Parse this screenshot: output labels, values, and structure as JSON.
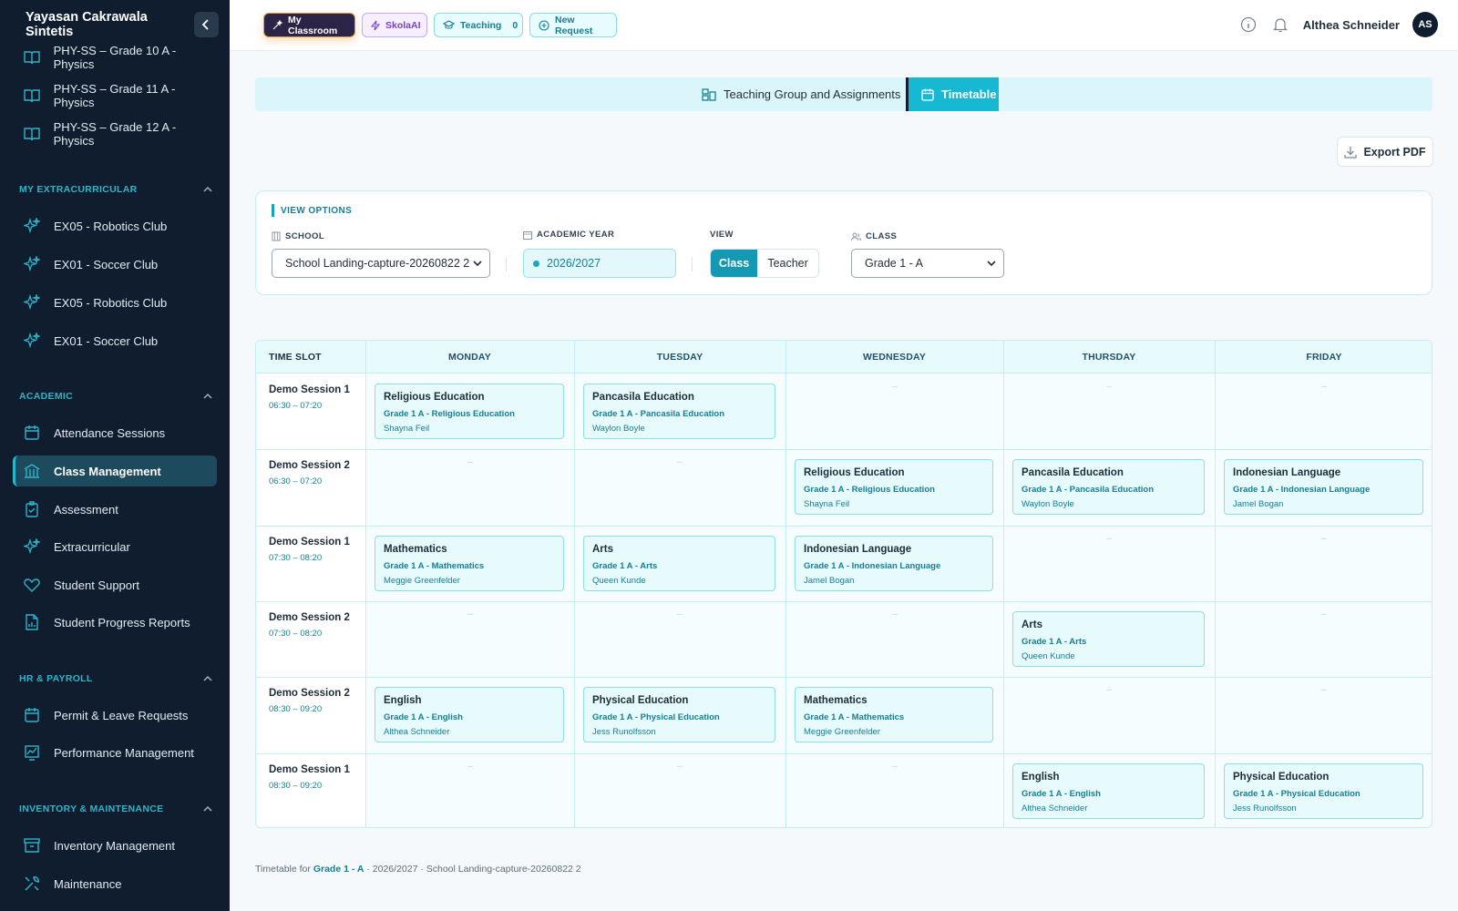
{
  "sidebar": {
    "title": "Yayasan Cakrawala Sintetis",
    "courses": [
      {
        "label": "PHY-SS – Grade 10 A - Physics"
      },
      {
        "label": "PHY-SS – Grade 11 A - Physics"
      },
      {
        "label": "PHY-SS – Grade 12 A - Physics"
      }
    ],
    "extracurricular_title": "MY EXTRACURRICULAR",
    "extracurricular": [
      {
        "label": "EX05 - Robotics Club"
      },
      {
        "label": "EX01 - Soccer Club"
      },
      {
        "label": "EX05 - Robotics Club"
      },
      {
        "label": "EX01 - Soccer Club"
      }
    ],
    "academic_title": "ACADEMIC",
    "academic": [
      {
        "label": "Attendance Sessions"
      },
      {
        "label": "Class Management"
      },
      {
        "label": "Assessment"
      },
      {
        "label": "Extracurricular"
      },
      {
        "label": "Student Support"
      },
      {
        "label": "Student Progress Reports"
      }
    ],
    "hr_title": "HR & PAYROLL",
    "hr": [
      {
        "label": "Permit & Leave Requests"
      },
      {
        "label": "Performance Management"
      }
    ],
    "inventory_title": "INVENTORY & MAINTENANCE",
    "inventory": [
      {
        "label": "Inventory Management"
      },
      {
        "label": "Maintenance"
      }
    ]
  },
  "topbar": {
    "pills": {
      "classroom": "My Classroom",
      "ai": "SkolaAI",
      "teaching": "Teaching",
      "teaching_count": "0",
      "request": "New Request"
    },
    "user_name": "Althea Schneider",
    "avatar_initials": "AS"
  },
  "tabs": {
    "groups": "Teaching Group and Assignments",
    "timetable": "Timetable"
  },
  "export_label": "Export PDF",
  "view_options": {
    "title": "VIEW OPTIONS",
    "school_label": "SCHOOL",
    "school_value": "School Landing-capture-20260822 2",
    "year_label": "ACADEMIC YEAR",
    "year_value": "2026/2027",
    "view_label": "VIEW",
    "view_class": "Class",
    "view_teacher": "Teacher",
    "class_label": "CLASS",
    "class_value": "Grade 1 - A"
  },
  "timetable": {
    "header_slot": "TIME SLOT",
    "days": [
      "MONDAY",
      "TUESDAY",
      "WEDNESDAY",
      "THURSDAY",
      "FRIDAY"
    ],
    "empty_mark": "–",
    "rows": [
      {
        "name": "Demo Session 1",
        "time": "06:30 – 07:20",
        "cells": [
          {
            "subject": "Religious Education",
            "group": "Grade 1 A - Religious Education",
            "teacher": "Shayna Feil"
          },
          {
            "subject": "Pancasila Education",
            "group": "Grade 1 A - Pancasila Education",
            "teacher": "Waylon Boyle"
          },
          null,
          null,
          null
        ]
      },
      {
        "name": "Demo Session 2",
        "time": "06:30 – 07:20",
        "cells": [
          null,
          null,
          {
            "subject": "Religious Education",
            "group": "Grade 1 A - Religious Education",
            "teacher": "Shayna Feil"
          },
          {
            "subject": "Pancasila Education",
            "group": "Grade 1 A - Pancasila Education",
            "teacher": "Waylon Boyle"
          },
          {
            "subject": "Indonesian Language",
            "group": "Grade 1 A - Indonesian Language",
            "teacher": "Jamel Bogan"
          }
        ]
      },
      {
        "name": "Demo Session 1",
        "time": "07:30 – 08:20",
        "cells": [
          {
            "subject": "Mathematics",
            "group": "Grade 1 A - Mathematics",
            "teacher": "Meggie Greenfelder"
          },
          {
            "subject": "Arts",
            "group": "Grade 1 A - Arts",
            "teacher": "Queen Kunde"
          },
          {
            "subject": "Indonesian Language",
            "group": "Grade 1 A - Indonesian Language",
            "teacher": "Jamel Bogan"
          },
          null,
          null
        ]
      },
      {
        "name": "Demo Session 2",
        "time": "07:30 – 08:20",
        "cells": [
          null,
          null,
          null,
          {
            "subject": "Arts",
            "group": "Grade 1 A - Arts",
            "teacher": "Queen Kunde"
          },
          null
        ]
      },
      {
        "name": "Demo Session 2",
        "time": "08:30 – 09:20",
        "cells": [
          {
            "subject": "English",
            "group": "Grade 1 A - English",
            "teacher": "Althea Schneider"
          },
          {
            "subject": "Physical Education",
            "group": "Grade 1 A - Physical Education",
            "teacher": "Jess Runolfsson"
          },
          {
            "subject": "Mathematics",
            "group": "Grade 1 A - Mathematics",
            "teacher": "Meggie Greenfelder"
          },
          null,
          null
        ]
      },
      {
        "name": "Demo Session 1",
        "time": "08:30 – 09:20",
        "cells": [
          null,
          null,
          null,
          {
            "subject": "English",
            "group": "Grade 1 A - English",
            "teacher": "Althea Schneider"
          },
          {
            "subject": "Physical Education",
            "group": "Grade 1 A - Physical Education",
            "teacher": "Jess Runolfsson"
          }
        ]
      }
    ]
  },
  "footer": {
    "prefix": "Timetable for",
    "class": "Grade 1 - A",
    "suffix": "· 2026/2027 · School Landing-capture-20260822 2"
  },
  "colors": {
    "sidebar_bg": "#0f1d2e",
    "accent": "#16b8d2",
    "accent_dark": "#157f95",
    "entry_bg": "#e7fafc"
  }
}
